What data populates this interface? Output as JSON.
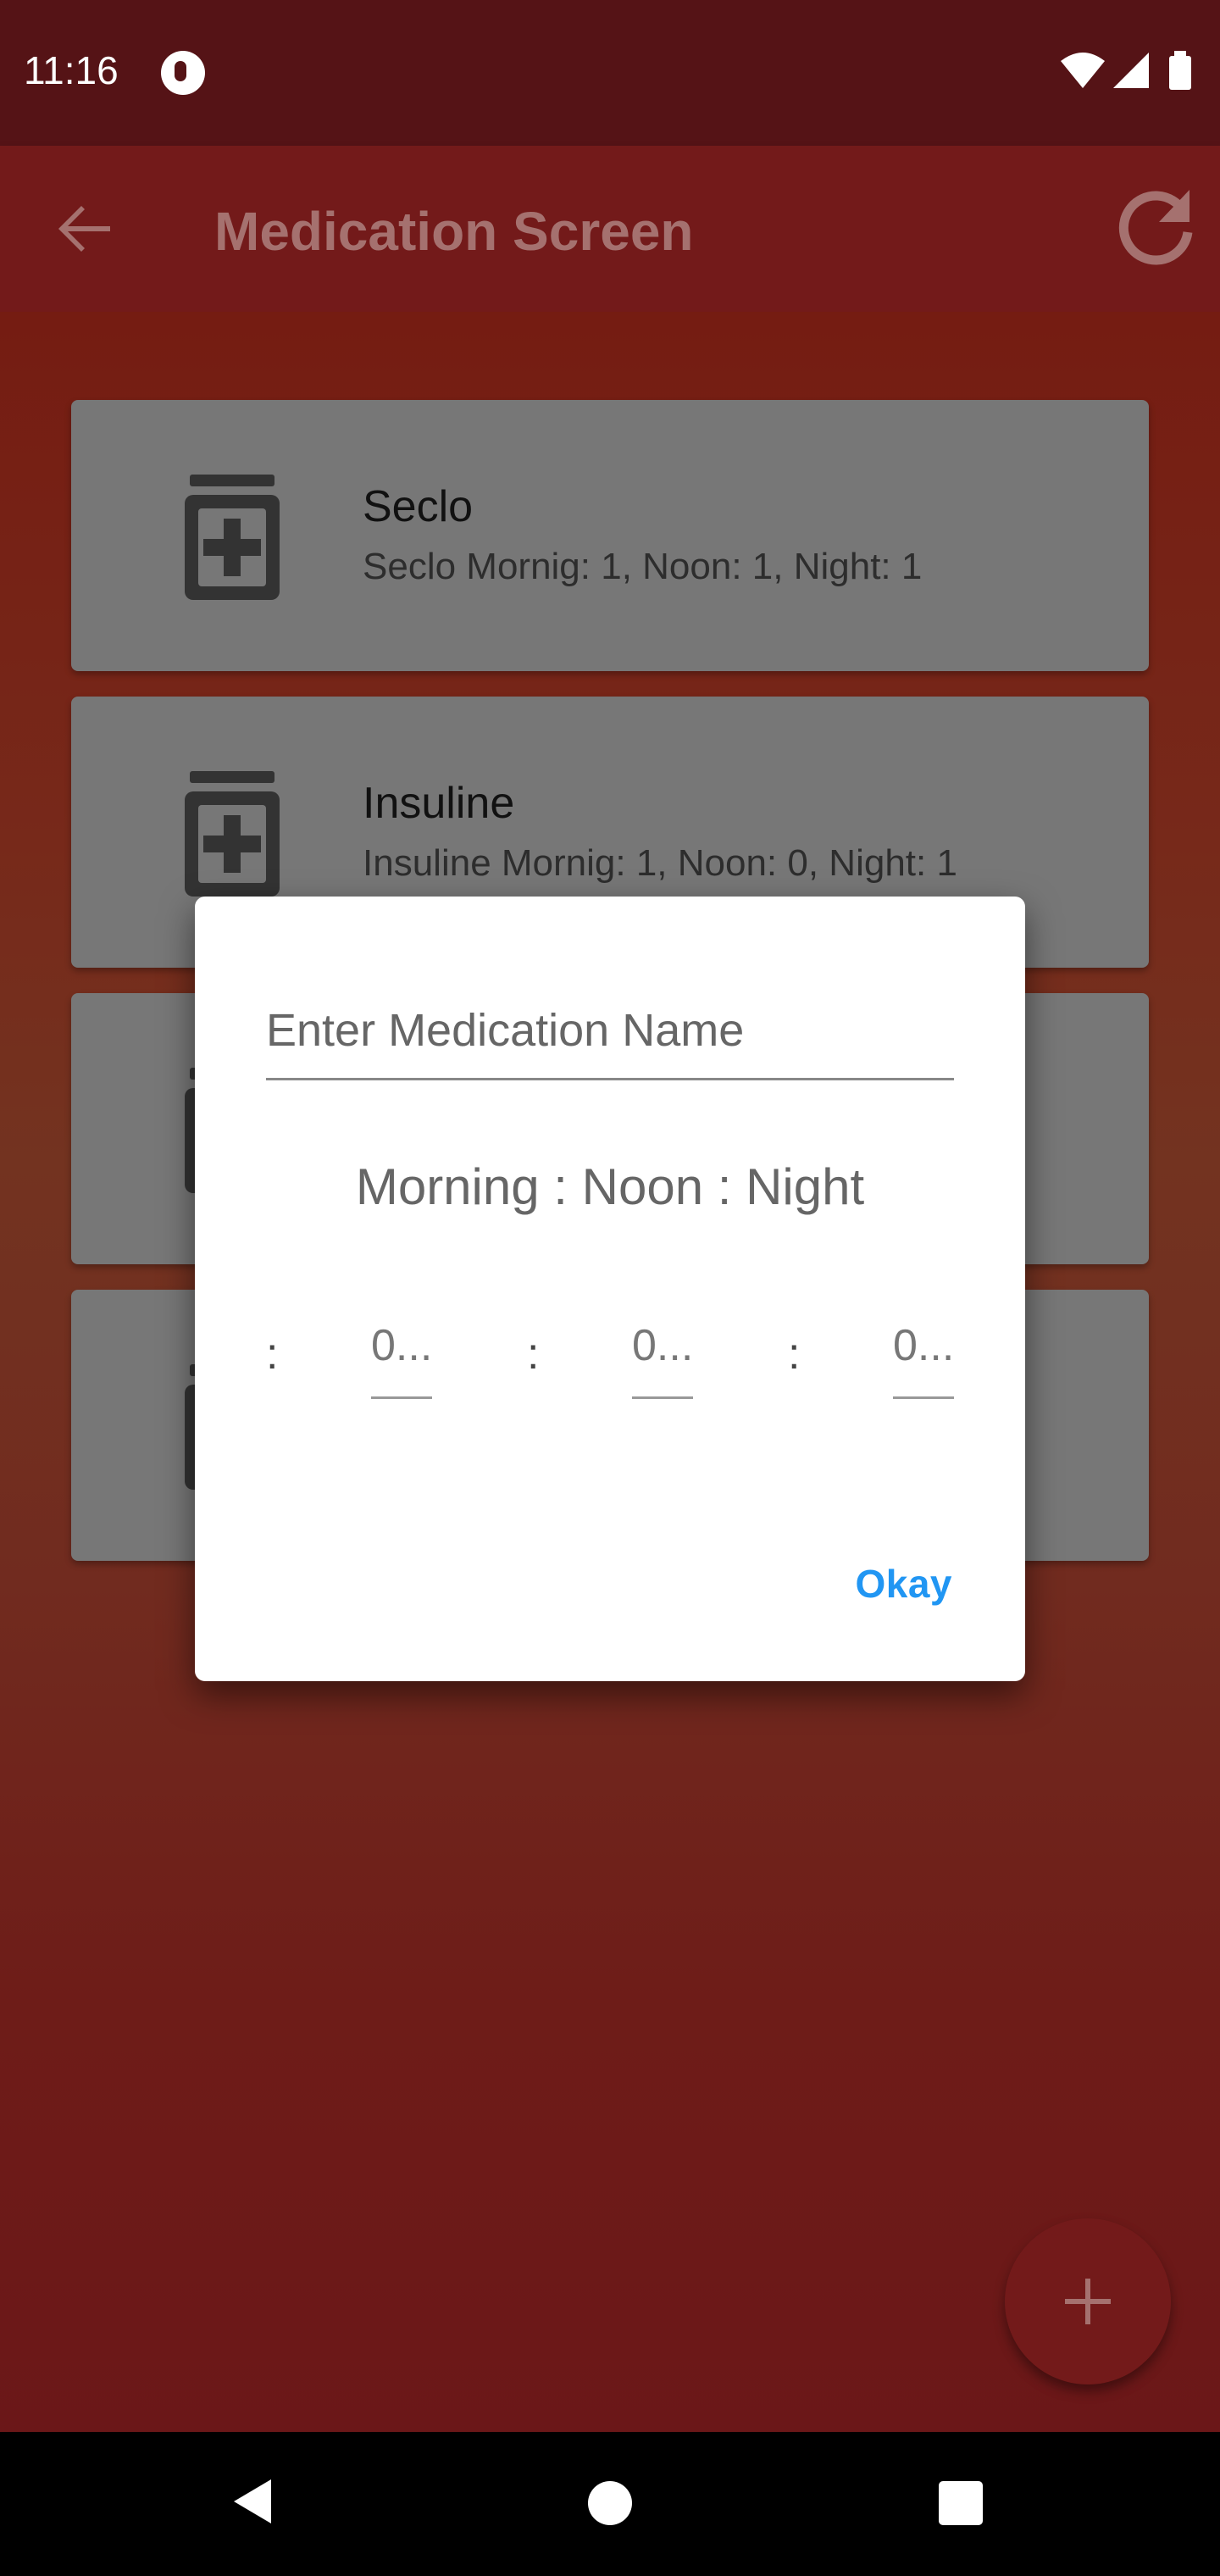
{
  "status_bar": {
    "time": "11:16",
    "app_icon": "app-notification-icon",
    "icons": [
      "wifi-icon",
      "signal-icon",
      "battery-icon"
    ]
  },
  "app_bar": {
    "title": "Medication Screen",
    "back_icon": "arrow-back-icon",
    "refresh_icon": "refresh-icon"
  },
  "medications": [
    {
      "name": "Seclo",
      "schedule": "Seclo Mornig: 1, Noon: 1, Night: 1"
    },
    {
      "name": "Insuline",
      "schedule": "Insuline Mornig: 1, Noon: 0, Night: 1"
    }
  ],
  "dialog": {
    "name_placeholder": "Enter Medication Name",
    "name_value": "",
    "schedule_caption": "Morning : Noon : Night",
    "separator": ":",
    "doses": [
      "0...",
      "0...",
      "0..."
    ],
    "okay_label": "Okay"
  },
  "fab": {
    "icon": "plus-icon"
  },
  "colors": {
    "status_bar": "#551316",
    "app_bar": "#731a1a",
    "card": "#777777",
    "accent": "#2196f3"
  }
}
